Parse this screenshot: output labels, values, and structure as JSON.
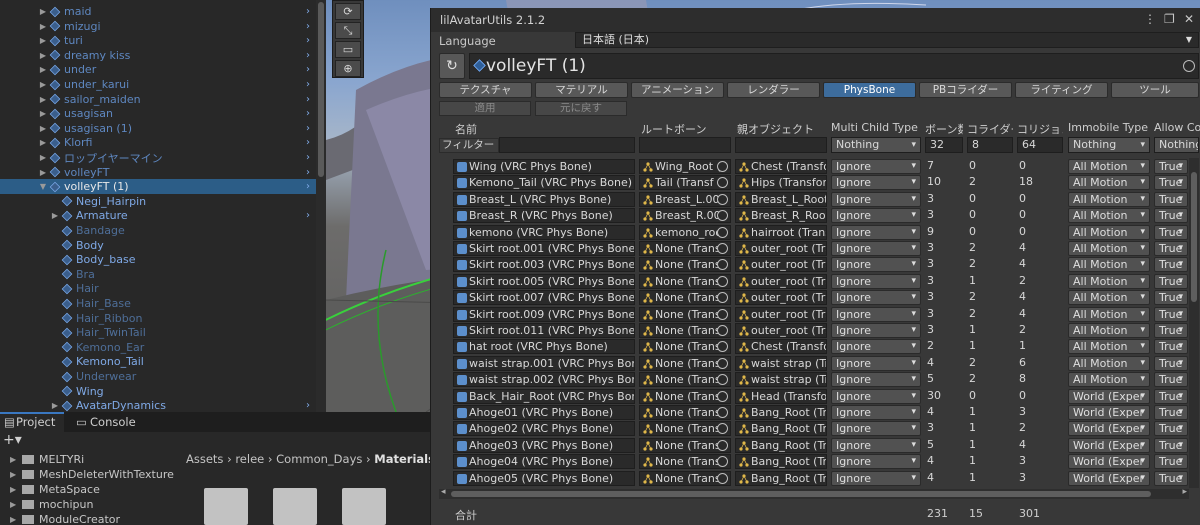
{
  "hierarchy": {
    "items": [
      {
        "label": "maid",
        "style": "b",
        "fold": "▶",
        "prefab": true
      },
      {
        "label": "mizugi",
        "style": "b",
        "fold": "▶",
        "prefab": true
      },
      {
        "label": "turi",
        "style": "b",
        "fold": "▶",
        "prefab": true
      },
      {
        "label": "dreamy kiss",
        "style": "b",
        "fold": "▶",
        "prefab": true
      },
      {
        "label": "under",
        "style": "b",
        "fold": "▶",
        "prefab": true
      },
      {
        "label": "under_karui",
        "style": "b",
        "fold": "▶",
        "prefab": true
      },
      {
        "label": "sailor_maiden",
        "style": "b",
        "fold": "▶",
        "prefab": true
      },
      {
        "label": "usagisan",
        "style": "b",
        "fold": "▶",
        "prefab": true
      },
      {
        "label": "usagisan (1)",
        "style": "b",
        "fold": "▶",
        "prefab": true
      },
      {
        "label": "Klorfi",
        "style": "b",
        "fold": "▶",
        "prefab": true
      },
      {
        "label": "ロップイヤーマイン",
        "style": "b",
        "fold": "▶",
        "prefab": true
      },
      {
        "label": "volleyFT",
        "style": "b",
        "fold": "▶",
        "prefab": true
      },
      {
        "label": "volleyFT (1)",
        "style": "sel",
        "fold": "▼",
        "prefab": true
      },
      {
        "label": "Negi_Hairpin",
        "style": "bc",
        "fold": "",
        "prefab": true
      },
      {
        "label": "Armature",
        "style": "bc",
        "fold": "▶",
        "prefab": true
      },
      {
        "label": "Bandage",
        "style": "dim",
        "fold": "",
        "prefab": true
      },
      {
        "label": "Body",
        "style": "bc",
        "fold": "",
        "prefab": true
      },
      {
        "label": "Body_base",
        "style": "bc",
        "fold": "",
        "prefab": true
      },
      {
        "label": "Bra",
        "style": "dim",
        "fold": "",
        "prefab": true
      },
      {
        "label": "Hair",
        "style": "dim",
        "fold": "",
        "prefab": true
      },
      {
        "label": "Hair_Base",
        "style": "dim",
        "fold": "",
        "prefab": true
      },
      {
        "label": "Hair_Ribbon",
        "style": "dim",
        "fold": "",
        "prefab": true
      },
      {
        "label": "Hair_TwinTail",
        "style": "dim",
        "fold": "",
        "prefab": true
      },
      {
        "label": "Kemono_Ear",
        "style": "dim",
        "fold": "",
        "prefab": true
      },
      {
        "label": "Kemono_Tail",
        "style": "bc",
        "fold": "",
        "prefab": true
      },
      {
        "label": "Underwear",
        "style": "dim",
        "fold": "",
        "prefab": true
      },
      {
        "label": "Wing",
        "style": "bc",
        "fold": "",
        "prefab": true
      },
      {
        "label": "AvatarDynamics",
        "style": "bc",
        "fold": "▶",
        "prefab": true
      }
    ]
  },
  "scene_tools": [
    "⟳",
    "⤡",
    "▭",
    "⊕"
  ],
  "bottom": {
    "tabs": {
      "project": "Project",
      "console": "Console"
    },
    "plus": "+▾",
    "folders": [
      "MELTYRi",
      "MeshDeleterWithTexture",
      "MetaSpace",
      "mochipun",
      "ModuleCreator"
    ],
    "breadcrumb": {
      "path": "Assets  ›  relee  ›  Common_Days  ›",
      "current": "Materials"
    }
  },
  "window": {
    "title": "lilAvatarUtils 2.1.2",
    "controls": {
      "menu": "⋮",
      "max": "❐",
      "close": "✕"
    },
    "language_label": "Language",
    "language_value": "日本語 (日本)",
    "refresh_icon": "↻",
    "avatar_name": "volleyFT (1)",
    "tabs": [
      "テクスチャ",
      "マテリアル",
      "アニメーション",
      "レンダラー",
      "PhysBone",
      "PBコライダー",
      "ライティング",
      "ツール"
    ],
    "active_tab": 4,
    "apply_label": "適用",
    "revert_label": "元に戻す",
    "columns": [
      "名前",
      "ルートボーン",
      "親オブジェクト",
      "Multi Child Type",
      "ボーン数",
      "コライダー数",
      "コリジョン数",
      "Immobile Type",
      "Allow Co"
    ],
    "filter": {
      "label": "フィルター",
      "multi_child": "Nothing",
      "bones": "32",
      "colliders": "8",
      "collisions": "64",
      "immobile": "Nothing",
      "allow": "Nothing"
    },
    "rows": [
      {
        "name": "Wing (VRC Phys Bone)",
        "root": "Wing_Root (",
        "parent": "Chest (Transfo",
        "multi": "Ignore",
        "bones": "7",
        "colliders": "0",
        "collisions": "0",
        "immobile": "All Motion",
        "allow": "True"
      },
      {
        "name": "Kemono_Tail (VRC Phys Bone)",
        "root": "Tail (Transf",
        "parent": "Hips (Transfor",
        "multi": "Ignore",
        "bones": "10",
        "colliders": "2",
        "collisions": "18",
        "immobile": "All Motion",
        "allow": "True"
      },
      {
        "name": "Breast_L (VRC Phys Bone)",
        "root": "Breast_L.00",
        "parent": "Breast_L_Root",
        "multi": "Ignore",
        "bones": "3",
        "colliders": "0",
        "collisions": "0",
        "immobile": "All Motion",
        "allow": "True"
      },
      {
        "name": "Breast_R (VRC Phys Bone)",
        "root": "Breast_R.00",
        "parent": "Breast_R_Root",
        "multi": "Ignore",
        "bones": "3",
        "colliders": "0",
        "collisions": "0",
        "immobile": "All Motion",
        "allow": "True"
      },
      {
        "name": "kemono (VRC Phys Bone)",
        "root": "kemono_roo",
        "parent": "hairroot (Trans",
        "multi": "Ignore",
        "bones": "9",
        "colliders": "0",
        "collisions": "0",
        "immobile": "All Motion",
        "allow": "True"
      },
      {
        "name": "Skirt root.001 (VRC Phys Bone)",
        "root": "None (Trans",
        "parent": "outer_root (Tra",
        "multi": "Ignore",
        "bones": "3",
        "colliders": "2",
        "collisions": "4",
        "immobile": "All Motion",
        "allow": "True"
      },
      {
        "name": "Skirt root.003 (VRC Phys Bone)",
        "root": "None (Trans",
        "parent": "outer_root (Tra",
        "multi": "Ignore",
        "bones": "3",
        "colliders": "2",
        "collisions": "4",
        "immobile": "All Motion",
        "allow": "True"
      },
      {
        "name": "Skirt root.005 (VRC Phys Bone)",
        "root": "None (Trans",
        "parent": "outer_root (Tra",
        "multi": "Ignore",
        "bones": "3",
        "colliders": "1",
        "collisions": "2",
        "immobile": "All Motion",
        "allow": "True"
      },
      {
        "name": "Skirt root.007 (VRC Phys Bone)",
        "root": "None (Trans",
        "parent": "outer_root (Tra",
        "multi": "Ignore",
        "bones": "3",
        "colliders": "2",
        "collisions": "4",
        "immobile": "All Motion",
        "allow": "True"
      },
      {
        "name": "Skirt root.009 (VRC Phys Bone)",
        "root": "None (Trans",
        "parent": "outer_root (Tra",
        "multi": "Ignore",
        "bones": "3",
        "colliders": "2",
        "collisions": "4",
        "immobile": "All Motion",
        "allow": "True"
      },
      {
        "name": "Skirt root.011 (VRC Phys Bone)",
        "root": "None (Trans",
        "parent": "outer_root (Tra",
        "multi": "Ignore",
        "bones": "3",
        "colliders": "1",
        "collisions": "2",
        "immobile": "All Motion",
        "allow": "True"
      },
      {
        "name": "hat root (VRC Phys Bone)",
        "root": "None (Trans",
        "parent": "Chest (Transfo",
        "multi": "Ignore",
        "bones": "2",
        "colliders": "1",
        "collisions": "1",
        "immobile": "All Motion",
        "allow": "True"
      },
      {
        "name": "waist strap.001 (VRC Phys Bone",
        "root": "None (Trans",
        "parent": "waist strap (Tr",
        "multi": "Ignore",
        "bones": "4",
        "colliders": "2",
        "collisions": "6",
        "immobile": "All Motion",
        "allow": "True"
      },
      {
        "name": "waist strap.002 (VRC Phys Bone",
        "root": "None (Trans",
        "parent": "waist strap (Tr",
        "multi": "Ignore",
        "bones": "5",
        "colliders": "2",
        "collisions": "8",
        "immobile": "All Motion",
        "allow": "True"
      },
      {
        "name": "Back_Hair_Root (VRC Phys Bone",
        "root": "None (Trans",
        "parent": "Head (Transfo",
        "multi": "Ignore",
        "bones": "30",
        "colliders": "0",
        "collisions": "0",
        "immobile": "World (Exper",
        "allow": "True"
      },
      {
        "name": "Ahoge01 (VRC Phys Bone)",
        "root": "None (Trans",
        "parent": "Bang_Root (Tr",
        "multi": "Ignore",
        "bones": "4",
        "colliders": "1",
        "collisions": "3",
        "immobile": "World (Exper",
        "allow": "True"
      },
      {
        "name": "Ahoge02 (VRC Phys Bone)",
        "root": "None (Trans",
        "parent": "Bang_Root (Tr",
        "multi": "Ignore",
        "bones": "3",
        "colliders": "1",
        "collisions": "2",
        "immobile": "World (Exper",
        "allow": "True"
      },
      {
        "name": "Ahoge03 (VRC Phys Bone)",
        "root": "None (Trans",
        "parent": "Bang_Root (Tr",
        "multi": "Ignore",
        "bones": "5",
        "colliders": "1",
        "collisions": "4",
        "immobile": "World (Exper",
        "allow": "True"
      },
      {
        "name": "Ahoge04 (VRC Phys Bone)",
        "root": "None (Trans",
        "parent": "Bang_Root (Tr",
        "multi": "Ignore",
        "bones": "4",
        "colliders": "1",
        "collisions": "3",
        "immobile": "World (Exper",
        "allow": "True"
      },
      {
        "name": "Ahoge05 (VRC Phys Bone)",
        "root": "None (Trans",
        "parent": "Bang_Root (Tr",
        "multi": "Ignore",
        "bones": "4",
        "colliders": "1",
        "collisions": "3",
        "immobile": "World (Exper",
        "allow": "True"
      }
    ],
    "totals": {
      "label": "合計",
      "bones": "231",
      "colliders": "15",
      "collisions": "301"
    }
  },
  "colors": {
    "accent": "#3d6c9c",
    "selection": "#2c5d87",
    "prefab_text": "#7fa9e6"
  }
}
